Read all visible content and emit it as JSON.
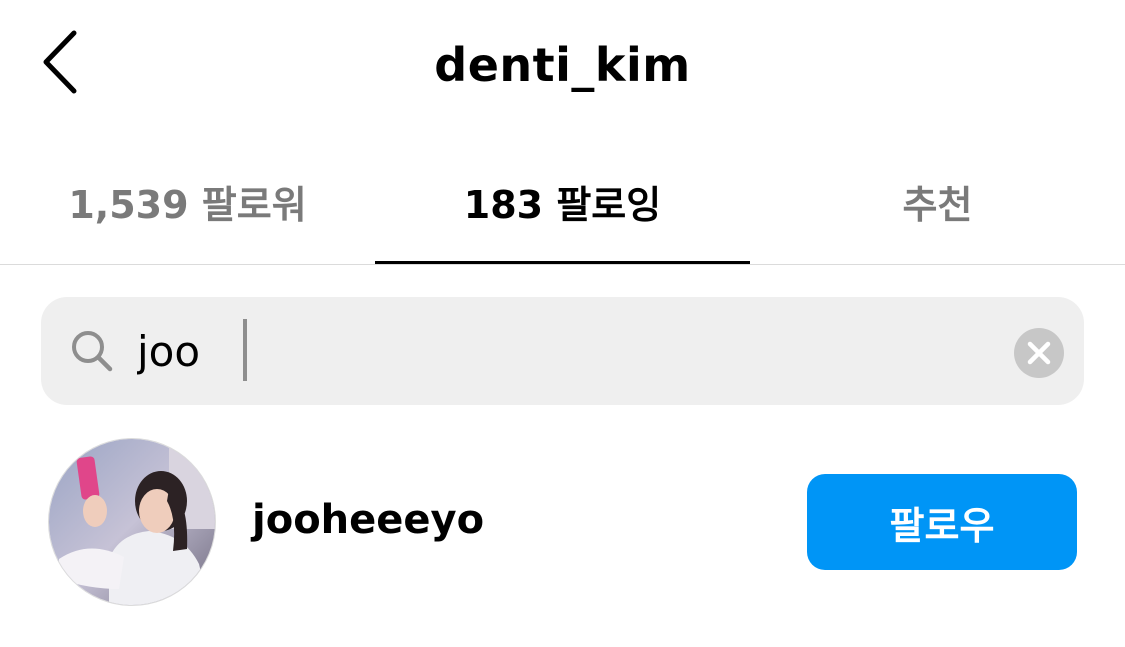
{
  "header": {
    "title": "denti_kim",
    "back_icon": "chevron-left-icon"
  },
  "tabs": [
    {
      "label": "1,539 팔로워",
      "active": false
    },
    {
      "label": "183 팔로잉",
      "active": true
    },
    {
      "label": "추천",
      "active": false
    }
  ],
  "search": {
    "value": "joo",
    "placeholder": "",
    "icon": "search-icon",
    "clear_icon": "clear-icon"
  },
  "results": [
    {
      "username": "jooheeeyo",
      "button_label": "팔로우",
      "avatar_icon": "avatar"
    }
  ],
  "colors": {
    "accent": "#0095f6",
    "inactive_tab": "#7a7a7a",
    "search_bg": "#efefef",
    "divider": "#dbdbdb"
  }
}
